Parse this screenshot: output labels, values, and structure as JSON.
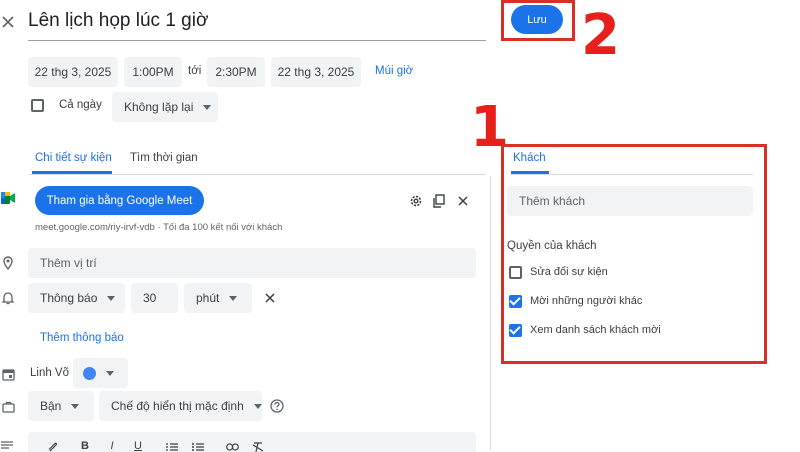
{
  "header": {
    "title": "Lên lịch họp lúc 1 giờ",
    "save_label": "Lưu"
  },
  "datetime": {
    "start_date": "22 thg 3, 2025",
    "start_time": "1:00PM",
    "to_label": "tới",
    "end_time": "2:30PM",
    "end_date": "22 thg 3, 2025",
    "timezone_label": "Múi giờ",
    "all_day_label": "Cả ngày",
    "repeat_label": "Không lặp lại"
  },
  "tabs": [
    {
      "label": "Chi tiết sự kiện"
    },
    {
      "label": "Tìm thời gian"
    }
  ],
  "meet": {
    "join_label": "Tham gia bằng Google Meet",
    "link_text": "meet.google.com/riy-irvf-vdb · Tối đa 100 kết nối với khách"
  },
  "location": {
    "placeholder": "Thêm vị trí"
  },
  "notification": {
    "type": "Thông báo",
    "value": "30",
    "unit": "phút",
    "add_label": "Thêm thông báo"
  },
  "calendar": {
    "owner": "Linh Võ",
    "color": "#4285f4"
  },
  "status": {
    "busy_label": "Bận",
    "visibility_label": "Chế độ hiển thị mặc định"
  },
  "guests": {
    "tab_label": "Khách",
    "add_placeholder": "Thêm khách",
    "permissions_title": "Quyền của khách",
    "permissions": [
      {
        "label": "Sửa đổi sự kiện",
        "checked": false
      },
      {
        "label": "Mời những người khác",
        "checked": true
      },
      {
        "label": "Xem danh sách khách mời",
        "checked": true
      }
    ]
  },
  "annotations": {
    "num1": "1",
    "num2": "2"
  },
  "colors": {
    "accent": "#1a73e8",
    "annotation_red": "#d93025"
  }
}
